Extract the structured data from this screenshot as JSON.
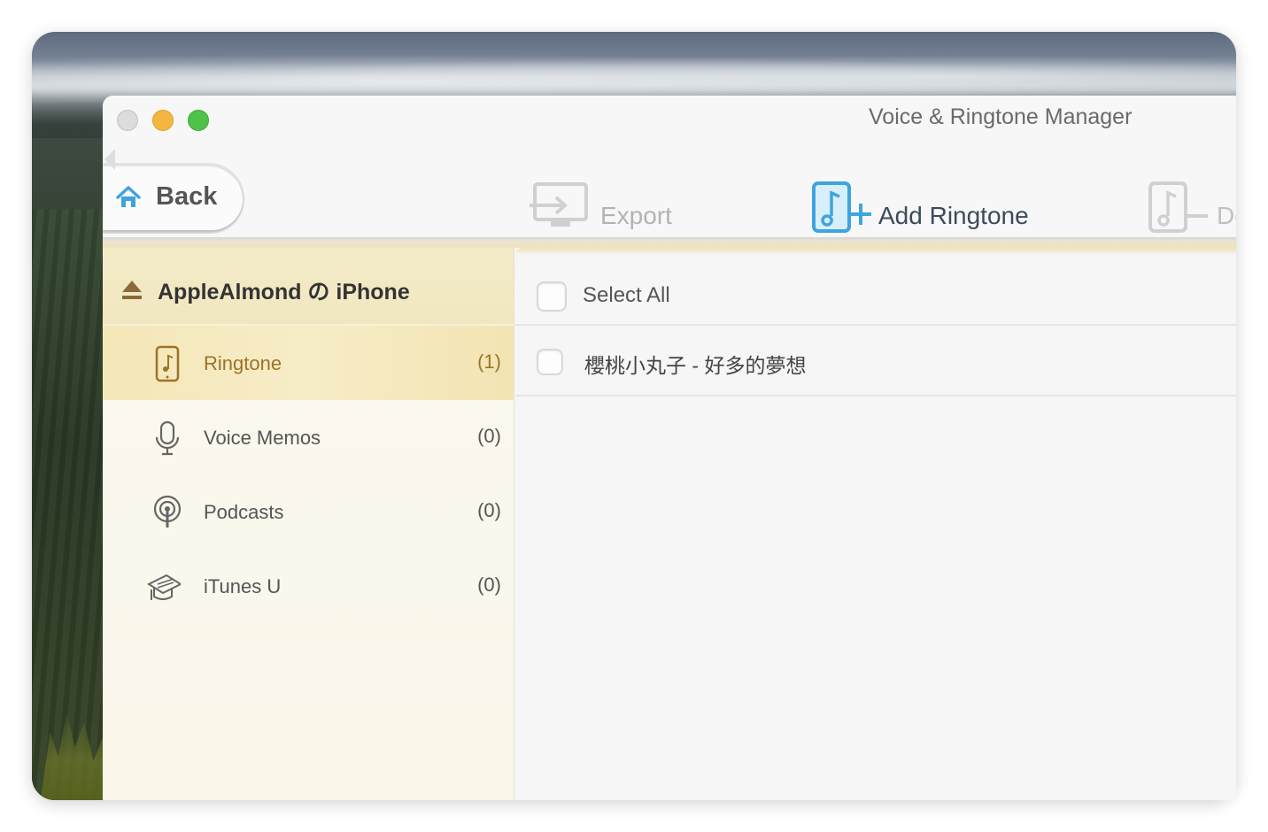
{
  "window": {
    "title": "Voice & Ringtone Manager"
  },
  "toolbar": {
    "back_label": "Back",
    "export_label": "Export",
    "add_ringtone_label": "Add Ringtone",
    "delete_label": "De"
  },
  "sidebar": {
    "device_name": "AppleAlmond の iPhone",
    "items": [
      {
        "label": "Ringtone",
        "count": "(1)",
        "icon": "phone-music-icon",
        "active": true
      },
      {
        "label": "Voice Memos",
        "count": "(0)",
        "icon": "microphone-icon",
        "active": false
      },
      {
        "label": "Podcasts",
        "count": "(0)",
        "icon": "podcast-icon",
        "active": false
      },
      {
        "label": "iTunes U",
        "count": "(0)",
        "icon": "graduation-cap-icon",
        "active": false
      }
    ]
  },
  "list": {
    "select_all_label": "Select All",
    "items": [
      {
        "title": "櫻桃小丸子 - 好多的夢想"
      }
    ]
  },
  "colors": {
    "active_accent": "#9c7428",
    "sidebar_highlight": "#f4e7b8",
    "add_icon": "#3fa4dd"
  }
}
